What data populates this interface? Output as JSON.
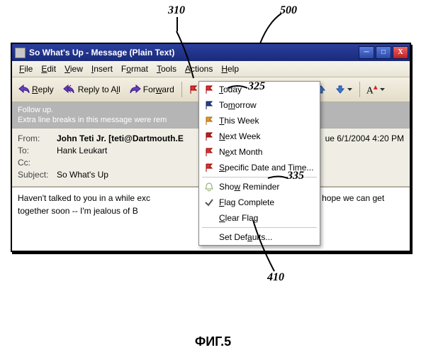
{
  "figure_label": "ФИГ.5",
  "annotations": {
    "dropdown_arrow": "310",
    "window": "500",
    "today": "325",
    "show_reminder": "335",
    "menu_body": "410"
  },
  "titlebar": {
    "title": "So What's Up - Message (Plain Text)"
  },
  "menubar": {
    "file": "File",
    "edit": "Edit",
    "view": "View",
    "insert": "Insert",
    "format": "Format",
    "tools": "Tools",
    "actions": "Actions",
    "help": "Help"
  },
  "toolbar": {
    "reply": "Reply",
    "reply_all": "Reply to All",
    "forward": "Forward"
  },
  "infobar": {
    "line1": "Follow up.",
    "line2": "Extra line breaks in this message were rem"
  },
  "headers": {
    "from_label": "From:",
    "from_value": "John Teti Jr. [teti@Dartmouth.E",
    "date_value": "ue 6/1/2004 4:20 PM",
    "to_label": "To:",
    "to_value": "Hank Leukart",
    "cc_label": "Cc:",
    "cc_value": "",
    "subject_label": "Subject:",
    "subject_value": "So What's Up"
  },
  "body": {
    "part1": "Haven't talked to you in a while exc",
    "part2": "s you and I hope we can get together soon -- I'm jealous of B"
  },
  "flagmenu": {
    "today": "Today",
    "tomorrow": "Tomorrow",
    "this_week": "This Week",
    "next_week": "Next Week",
    "next_month": "Next Month",
    "specific": "Specific Date and Time...",
    "show_reminder": "Show Reminder",
    "flag_complete": "Flag Complete",
    "clear_flag": "Clear Flag",
    "set_defaults": "Set Defaults..."
  }
}
